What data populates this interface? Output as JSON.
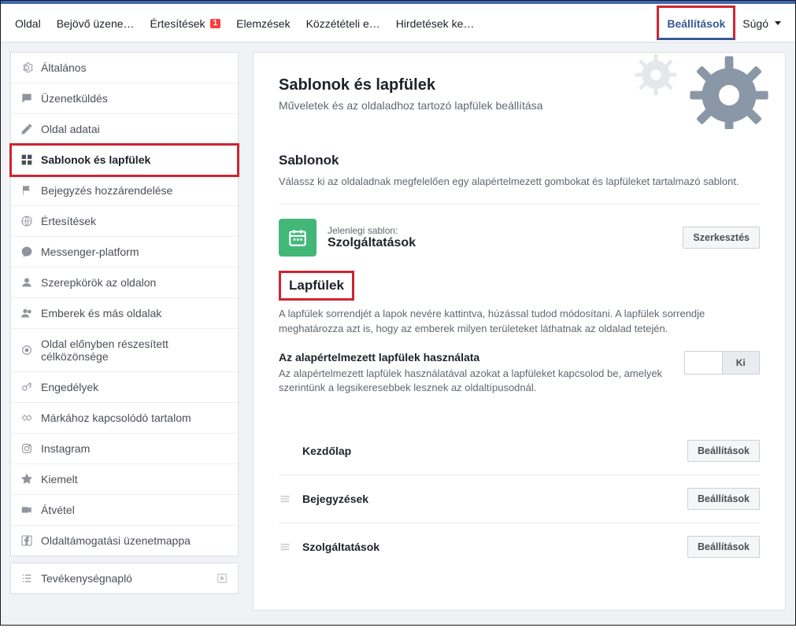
{
  "nav": {
    "items": [
      {
        "label": "Oldal"
      },
      {
        "label": "Bejövő üzene…"
      },
      {
        "label": "Értesítések",
        "badge": "1"
      },
      {
        "label": "Elemzések"
      },
      {
        "label": "Közzétételi e…"
      },
      {
        "label": "Hirdetések ke…"
      }
    ],
    "settings": "Beállítások",
    "help": "Súgó"
  },
  "sidebar": {
    "items": [
      {
        "label": "Általános"
      },
      {
        "label": "Üzenetküldés"
      },
      {
        "label": "Oldal adatai"
      },
      {
        "label": "Sablonok és lapfülek",
        "active": true
      },
      {
        "label": "Bejegyzés hozzárendelése"
      },
      {
        "label": "Értesítések"
      },
      {
        "label": "Messenger-platform"
      },
      {
        "label": "Szerepkörök az oldalon"
      },
      {
        "label": "Emberek és más oldalak"
      },
      {
        "label": "Oldal előnyben részesített célközönsége"
      },
      {
        "label": "Engedélyek"
      },
      {
        "label": "Márkához kapcsolódó tartalom"
      },
      {
        "label": "Instagram"
      },
      {
        "label": "Kiemelt"
      },
      {
        "label": "Átvétel"
      },
      {
        "label": "Oldaltámogatási üzenetmappa"
      }
    ],
    "activity": "Tevékenységnapló"
  },
  "hero": {
    "title": "Sablonok és lapfülek",
    "subtitle": "Műveletek és az oldaladhoz tartozó lapfülek beállítása"
  },
  "templates": {
    "heading": "Sablonok",
    "desc": "Válassz ki az oldaladnak megfelelően egy alapértelmezett gombokat és lapfüleket tartalmazó sablont.",
    "current_label": "Jelenlegi sablon:",
    "current_value": "Szolgáltatások",
    "edit": "Szerkesztés"
  },
  "tabs": {
    "heading": "Lapfülek",
    "desc": "A lapfülek sorrendjét a lapok nevére kattintva, húzással tudod módosítani. A lapfülek sorrendje meghatározza azt is, hogy az emberek milyen területeket láthatnak az oldalad tetején.",
    "default_title": "Az alapértelmezett lapfülek használata",
    "default_desc": "Az alapértelmezett lapfülek használatával azokat a lapfüleket kapcsolod be, amelyek szerintünk a legsikeresebbek lesznek az oldaltípusodnál.",
    "toggle_off": "Ki",
    "settings_btn": "Beállítások",
    "list": [
      {
        "name": "Kezdőlap",
        "locked": true
      },
      {
        "name": "Bejegyzések"
      },
      {
        "name": "Szolgáltatások"
      }
    ]
  }
}
